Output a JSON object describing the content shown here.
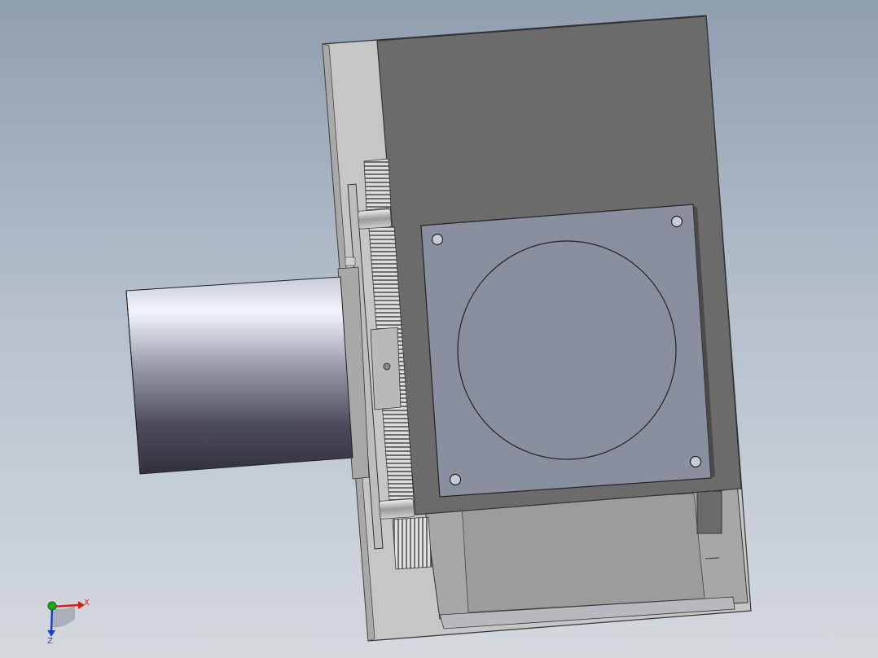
{
  "viewport": {
    "background_top": "#8f9eaf",
    "background_bottom": "#d4d9de"
  },
  "model": {
    "housing_color": "#6b6b6b",
    "plate_color": "#c4c4c4",
    "motor_face_color": "#8a8fa0",
    "cylinder_highlight": "#f2f4fa",
    "cylinder_shadow": "#32323e",
    "gear_color": "#d0d0d0"
  },
  "triad": {
    "x_label": "X",
    "z_label": "Z",
    "x_color": "#d42020",
    "y_color": "#1fa81f",
    "z_color": "#2040c8"
  }
}
